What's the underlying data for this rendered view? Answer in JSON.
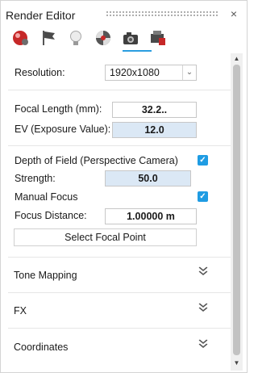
{
  "window": {
    "title": "Render Editor",
    "close_glyph": "×"
  },
  "toolbar": {
    "icons": [
      "render-ball-icon",
      "flag-icon",
      "lightbulb-icon",
      "environment-ball-icon",
      "camera-icon",
      "printer-icon"
    ],
    "selected": "camera-icon",
    "accent": "#2a9ee0"
  },
  "resolution": {
    "label": "Resolution:",
    "value": "1920x1080"
  },
  "focal_length": {
    "label": "Focal Length (mm):",
    "value": "32.2.."
  },
  "ev": {
    "label": "EV (Exposure Value):",
    "value": "12.0"
  },
  "dof": {
    "label": "Depth of Field (Perspective Camera)",
    "checked": true
  },
  "strength": {
    "label": "Strength:",
    "value": "50.0"
  },
  "manual_focus": {
    "label": "Manual Focus",
    "checked": true
  },
  "focus_distance": {
    "label": "Focus Distance:",
    "value": "1.00000 m"
  },
  "select_focal_point": {
    "label": "Select Focal Point"
  },
  "sections": [
    {
      "label": "Tone Mapping"
    },
    {
      "label": "FX"
    },
    {
      "label": "Coordinates"
    }
  ],
  "glyphs": {
    "check": "✓",
    "chevron_double": "⌄",
    "arrow_up": "▲",
    "arrow_down": "▼",
    "combo_arrow": "⌄"
  },
  "colors": {
    "checkbox": "#1f9ce3",
    "field_highlight": "#dbe8f5"
  }
}
